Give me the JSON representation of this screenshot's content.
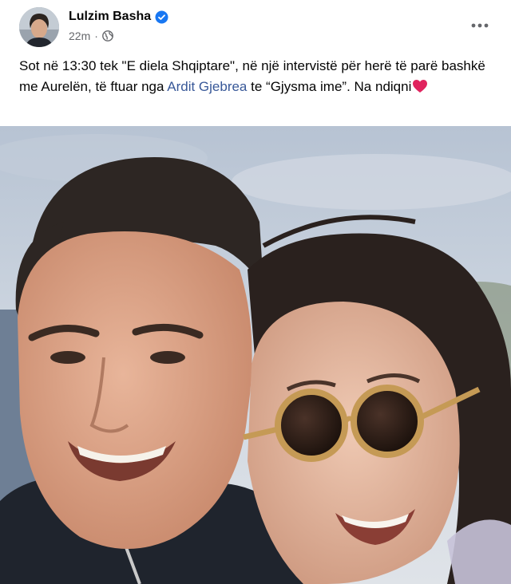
{
  "post": {
    "author": "Lulzim Basha",
    "verified_icon": "verified-badge-icon",
    "time": "22m",
    "dot": "·",
    "audience_icon": "globe-icon",
    "more_icon": "more-options-icon",
    "text": {
      "part1": "Sot në 13:30 tek \"E diela Shqiptare\", në një intervistë për herë të parë bashkë me Aurelën, të ftuar nga ",
      "link": "Ardit Gjebrea",
      "part2": " te “Gjysma ime”. Na ndiqni",
      "emoji": "heart-emoji"
    }
  },
  "colors": {
    "link": "#385898",
    "verified": "#1877f2",
    "secondary_text": "#65676b"
  }
}
